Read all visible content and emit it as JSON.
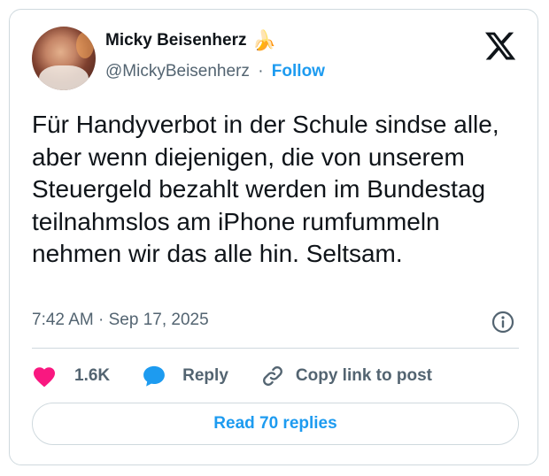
{
  "author": {
    "display_name": "Micky Beisenherz",
    "name_emoji": "🍌",
    "handle": "@MickyBeisenherz",
    "separator": "·",
    "follow_label": "Follow"
  },
  "tweet": {
    "text": "Für Handyverbot in der Schule sindse alle, aber wenn diejenigen, die von unserem Steuergeld bezahlt werden im Bundestag teilnahmslos am iPhone rumfummeln nehmen wir das alle hin. Seltsam.",
    "time": "7:42 AM",
    "separator": "·",
    "date": "Sep 17, 2025"
  },
  "actions": {
    "like_count": "1.6K",
    "reply_label": "Reply",
    "copy_label": "Copy link to post"
  },
  "footer": {
    "read_replies_label": "Read 70 replies"
  },
  "icons": {
    "like": "heart-icon",
    "reply": "speech-bubble-icon",
    "copy": "link-icon",
    "info": "info-icon",
    "brand": "x-logo-icon"
  },
  "colors": {
    "accent": "#1d9bf0",
    "like": "#f91880",
    "text": "#0f1419",
    "muted": "#536471",
    "border": "#cfd9de"
  }
}
